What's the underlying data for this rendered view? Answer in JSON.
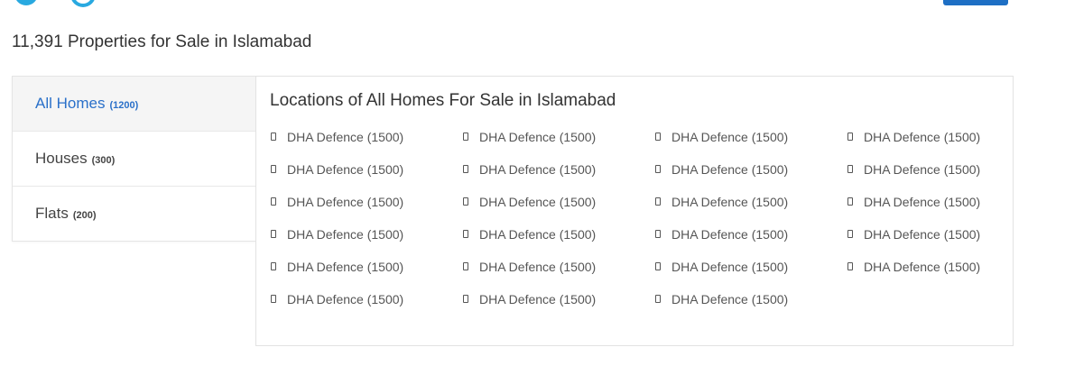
{
  "header": {
    "social_icons": [
      "twitter-icon",
      "social-circle-icon"
    ],
    "button_color": "#1e6fc4"
  },
  "page_title": "11,391 Properties for Sale in Islamabad",
  "categories": [
    {
      "label": "All Homes",
      "count": "(1200)",
      "active": true
    },
    {
      "label": "Houses",
      "count": "(300)",
      "active": false
    },
    {
      "label": "Flats",
      "count": "(200)",
      "active": false
    }
  ],
  "locations": {
    "title": "Locations of All Homes For Sale in Islamabad",
    "icon": "location-pin-icon",
    "items": [
      "DHA Defence (1500)",
      "DHA Defence (1500)",
      "DHA Defence (1500)",
      "DHA Defence (1500)",
      "DHA Defence (1500)",
      "DHA Defence (1500)",
      "DHA Defence (1500)",
      "DHA Defence (1500)",
      "DHA Defence (1500)",
      "DHA Defence (1500)",
      "DHA Defence (1500)",
      "DHA Defence (1500)",
      "DHA Defence (1500)",
      "DHA Defence (1500)",
      "DHA Defence (1500)",
      "DHA Defence (1500)",
      "DHA Defence (1500)",
      "DHA Defence (1500)",
      "DHA Defence (1500)",
      "DHA Defence (1500)",
      "DHA Defence (1500)",
      "DHA Defence (1500)",
      "DHA Defence (1500)"
    ]
  },
  "colors": {
    "accent": "#2a70c9",
    "active_bg": "#f5f5f5",
    "social": "#29a9e0"
  }
}
